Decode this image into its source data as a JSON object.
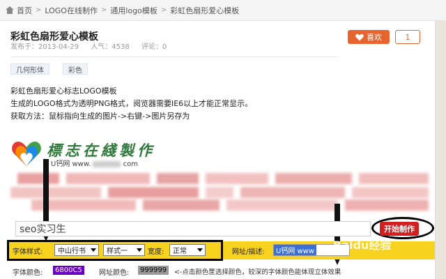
{
  "breadcrumb": {
    "items": [
      "首页",
      "LOGO在线制作",
      "通用logo模板",
      "彩虹色扇形爱心模板"
    ],
    "separator": ">"
  },
  "article": {
    "title": "彩虹色扇形爱心模板",
    "published": "发布于：2013-04-29",
    "views": "人气：4538",
    "comments": "评论：0",
    "like_label": "喜欢",
    "like_count": "1",
    "tags": [
      "几何形体",
      "彩色"
    ],
    "description": [
      "彩虹色扇形爱心标志LOGO模板",
      "生成的LOGO格式为透明PNG格式，阅览器需要IE6以上才能正常显示。",
      "获取方法：鼠标指向生成的图片->右键->图片另存为"
    ]
  },
  "logo_preview": {
    "text": "標志在綫製作",
    "subtitle": "U钙网 www."
  },
  "form": {
    "input_value": "seo实习生",
    "start_button": "开始制作",
    "font_style_label": "字体样式:",
    "font_select": "中山行书",
    "style_select": "样式一",
    "width_label": "宽度:",
    "width_select": "正常",
    "url_label": "网址/描述:",
    "url_value": "U钙网 www",
    "font_color_label": "字体颜色:",
    "font_color_value": "6800C5",
    "url_color_label": "网址颜色:",
    "url_color_value": "999999",
    "hint": "<-点击颜色筐选择颜色，较深的字体颜色能体现立体效果"
  },
  "watermark": "Baidu经验",
  "colors": {
    "accent": "#e8642e",
    "start": "#d21e1e",
    "bar": "#f7d21f",
    "font_color_swatch": "#6800c5",
    "url_color_swatch": "#999999"
  }
}
